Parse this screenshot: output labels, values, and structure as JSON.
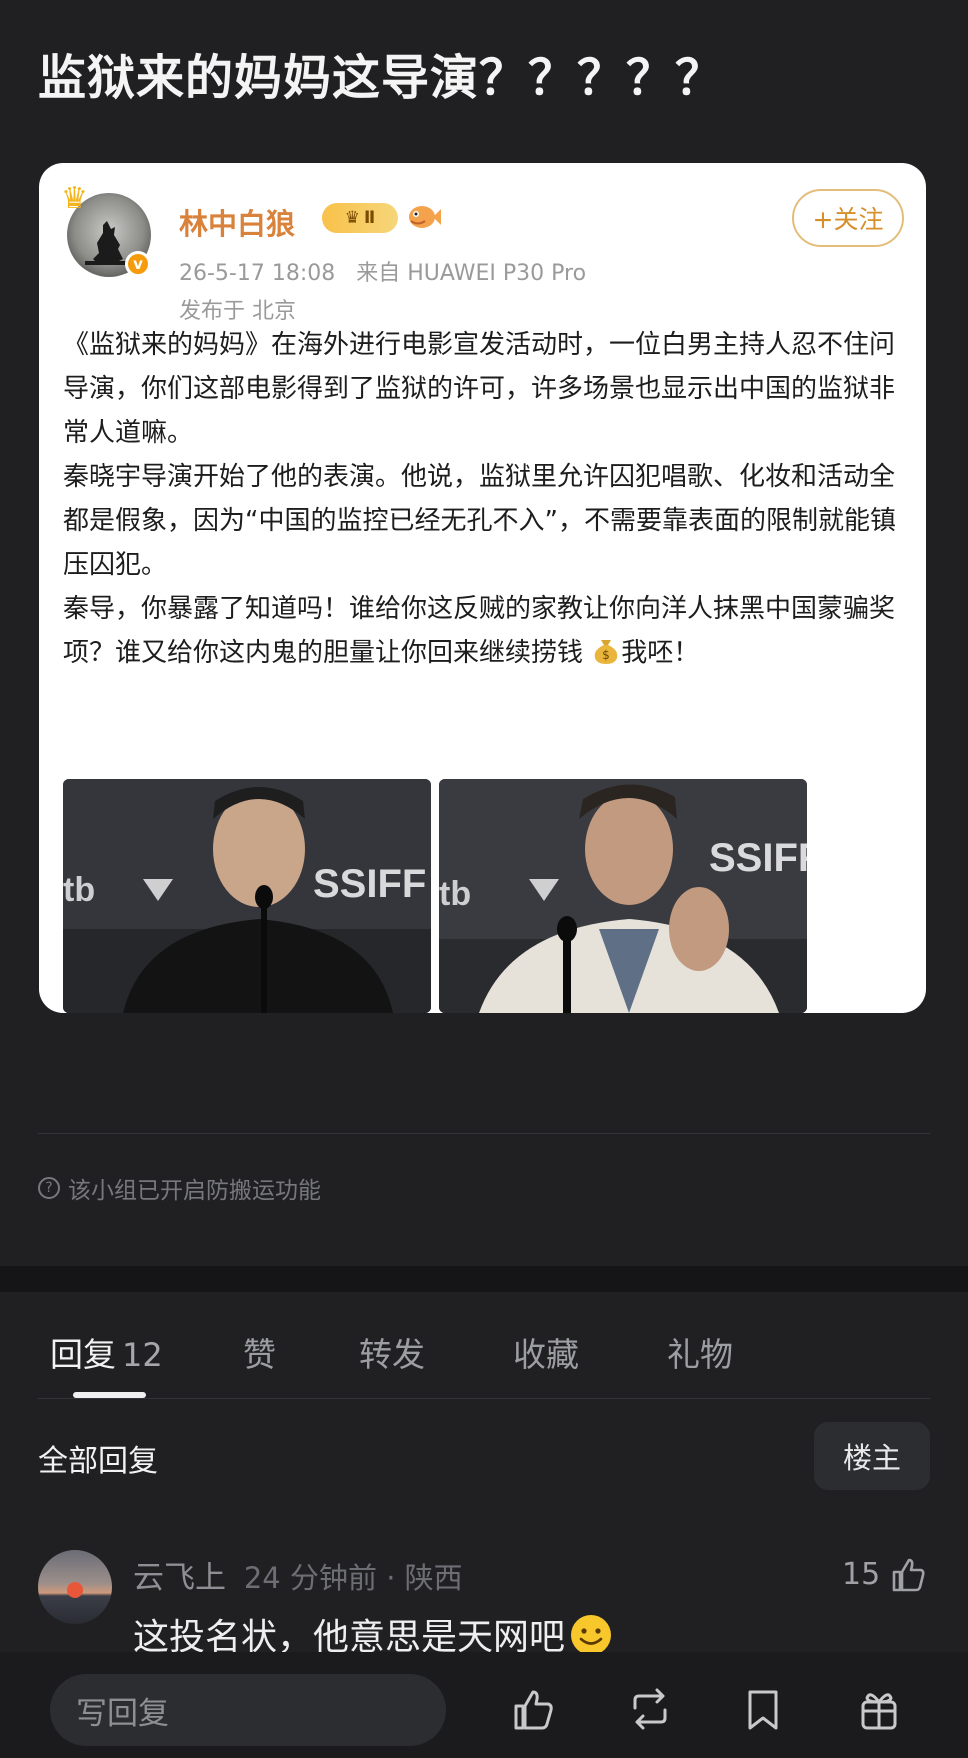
{
  "page": {
    "title": "监狱来的妈妈这导演？？？？？"
  },
  "post": {
    "username": "林中白狼",
    "member_level": "Ⅱ",
    "datetime": "26-5-17 18:08",
    "source": "来自 HUAWEI P30 Pro",
    "location": "发布于 北京",
    "follow_label": "+关注",
    "paragraphs": [
      "《监狱来的妈妈》在海外进行电影宣发活动时，一位白男主持人忍不住问导演，你们这部电影得到了监狱的许可，许多场景也显示出中国的监狱非常人道嘛。",
      "秦晓宇导演开始了他的表演。他说，监狱里允许囚犯唱歌、化妆和活动全都是假象，因为“中国的监控已经无孔不入”，不需要靠表面的限制就能镇压囚犯。",
      "秦导，你暴露了知道吗！谁给你这反贼的家教让你向洋人抹黑中国蒙骗奖项？谁又给你这内鬼的胆量让你回来继续捞钱"
    ],
    "closing": "我呸！",
    "photo_texts": [
      "SSIFF",
      "tb",
      "SSIFF",
      "tb"
    ]
  },
  "notice": {
    "anti_repost": "该小组已开启防搬运功能"
  },
  "tabs": [
    {
      "label": "回复",
      "count": "12"
    },
    {
      "label": "赞"
    },
    {
      "label": "转发"
    },
    {
      "label": "收藏"
    },
    {
      "label": "礼物"
    }
  ],
  "replies_header": {
    "title": "全部回复",
    "op_filter": "楼主"
  },
  "comment": {
    "user": "云飞上",
    "time_location": "24 分钟前 · 陕西",
    "text": "这投名状，他意思是天网吧",
    "likes": "15"
  },
  "bottom_bar": {
    "reply_placeholder": "写回复",
    "icons": [
      "like-icon",
      "repost-icon",
      "bookmark-icon",
      "gift-icon"
    ]
  },
  "colors": {
    "background": "#202022",
    "card": "#ffffff",
    "username": "#d9823b",
    "follow": "#d6902b"
  }
}
